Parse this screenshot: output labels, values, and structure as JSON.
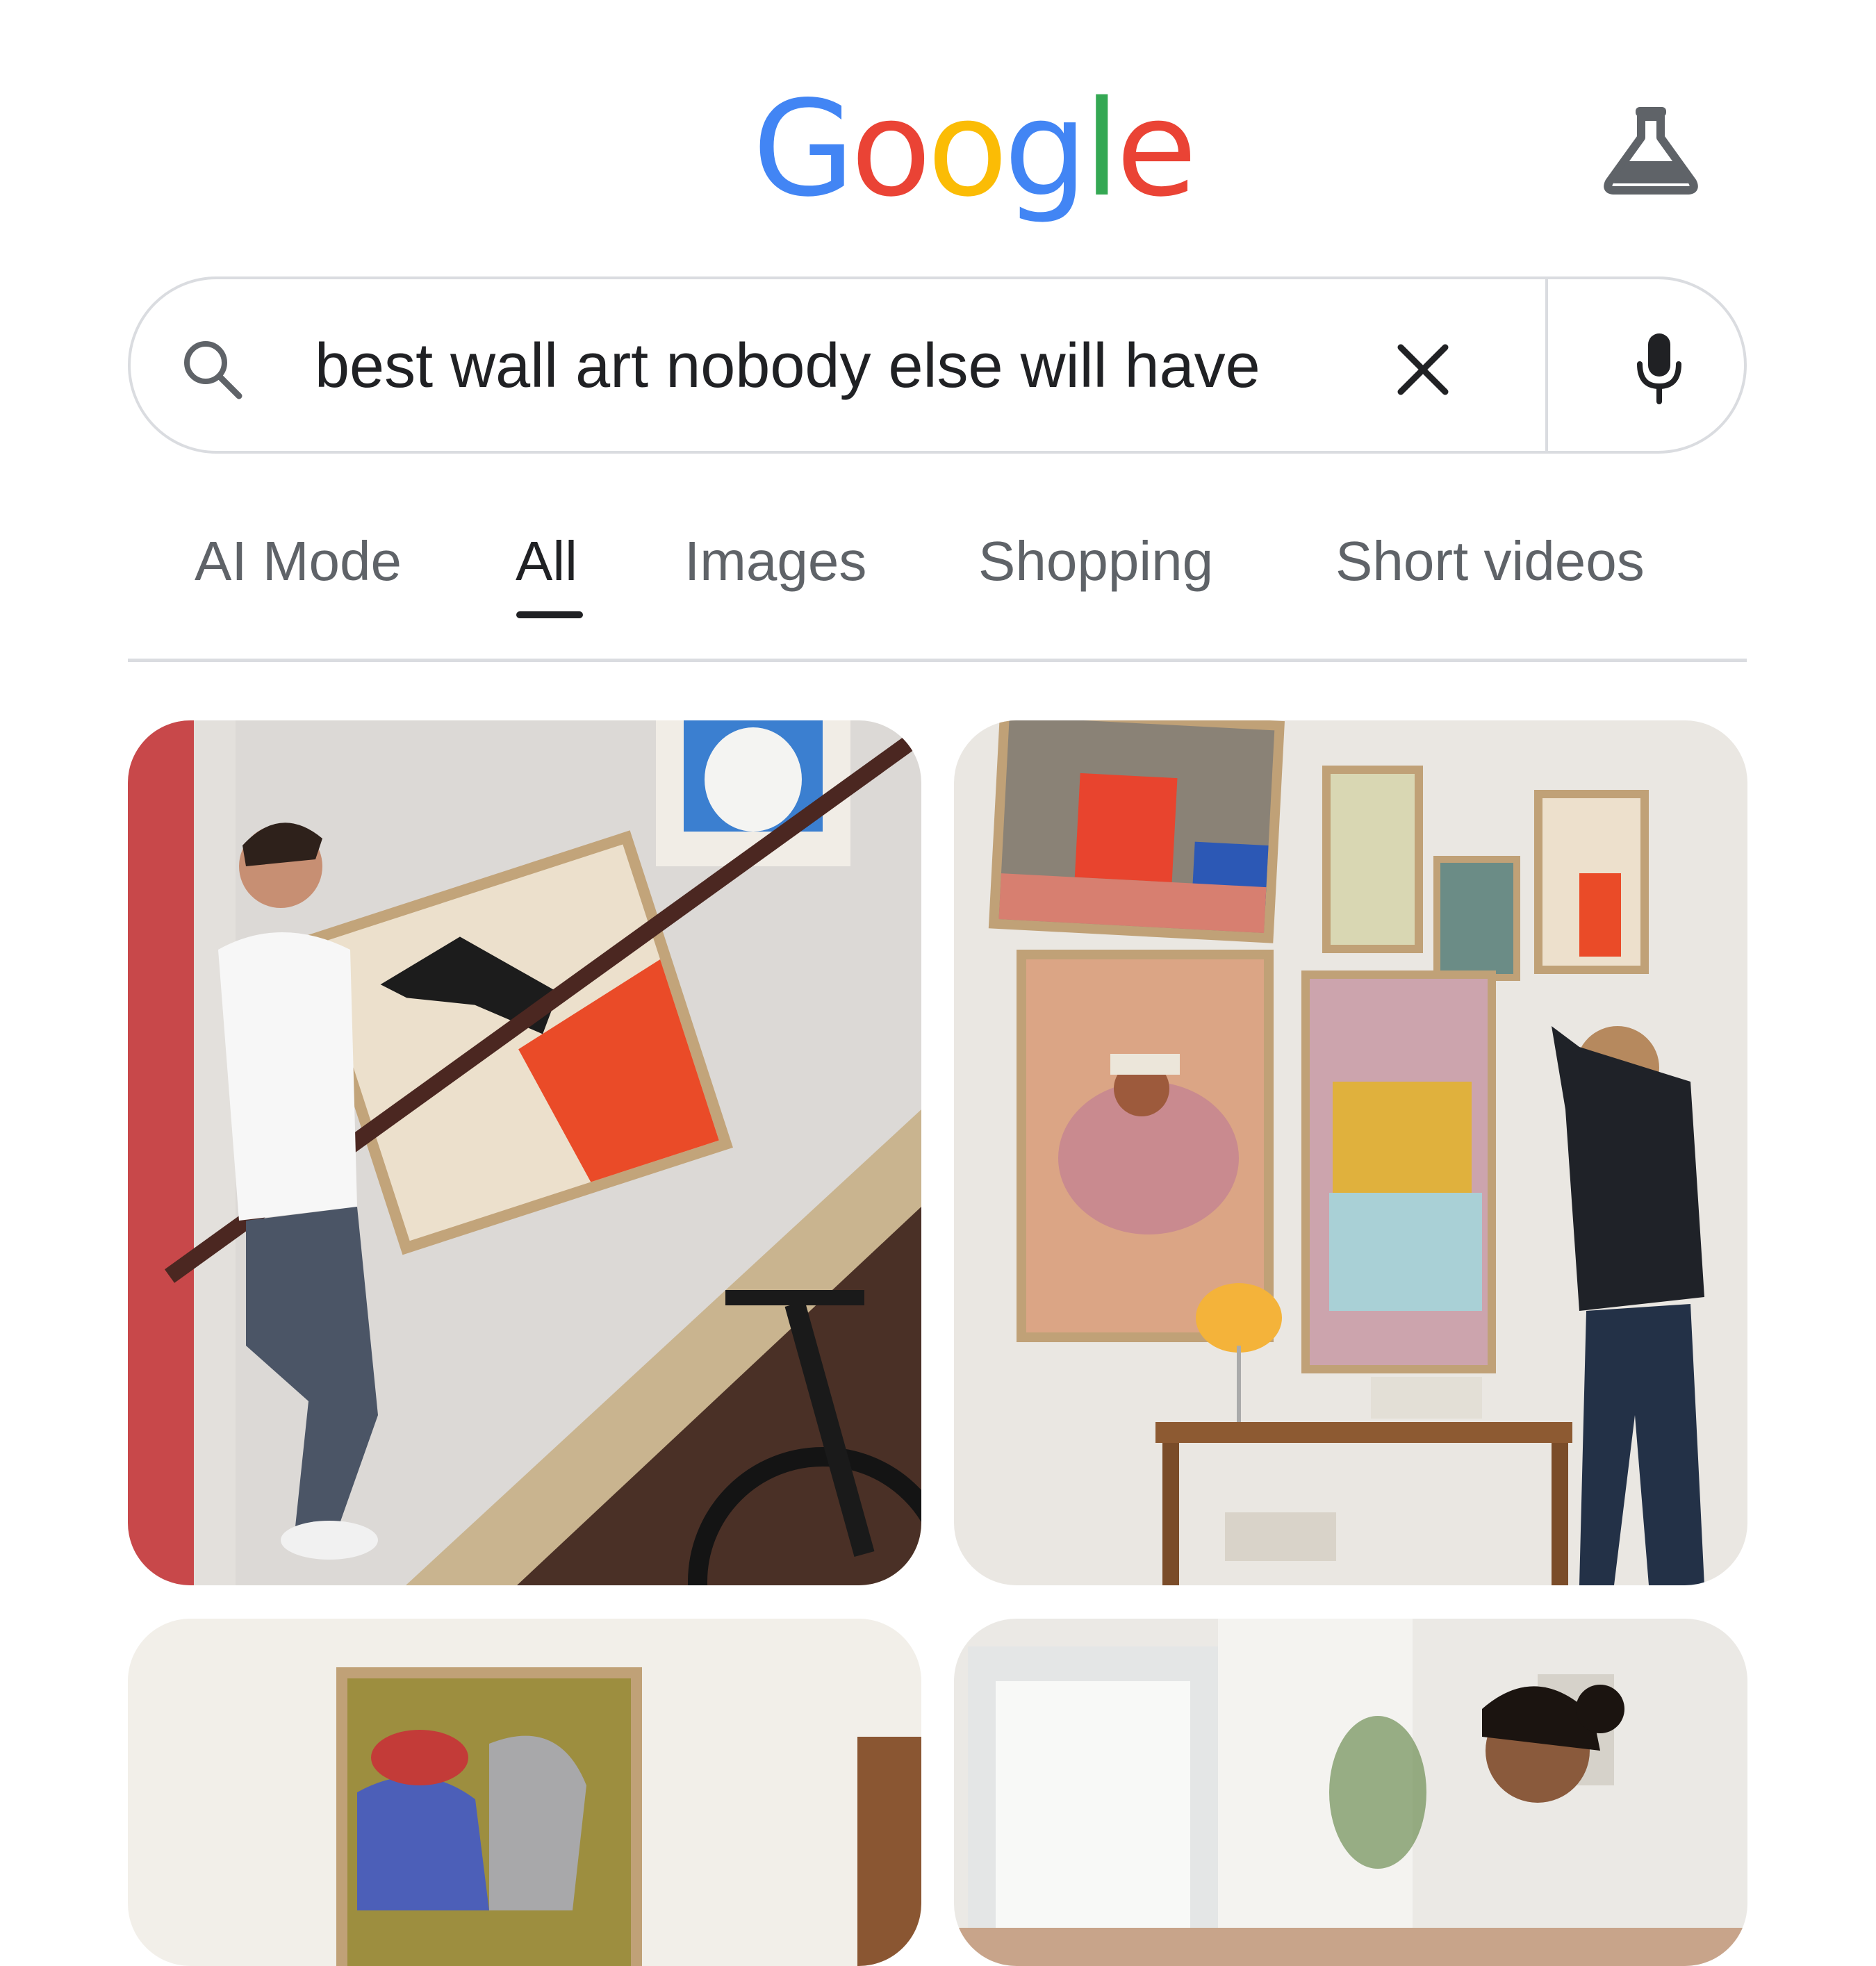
{
  "header": {
    "logo": {
      "letters": [
        "G",
        "o",
        "o",
        "g",
        "l",
        "e"
      ],
      "colors": [
        "#4285F4",
        "#EA4335",
        "#FBBC05",
        "#4285F4",
        "#34A853",
        "#EA4335"
      ]
    },
    "labs_icon": "flask-icon"
  },
  "search": {
    "query": "best wall art nobody else will have",
    "search_icon": "search-icon",
    "clear_icon": "close-icon",
    "voice_icon": "microphone-icon"
  },
  "tabs": [
    {
      "label": "AI Mode",
      "active": false
    },
    {
      "label": "All",
      "active": true
    },
    {
      "label": "Images",
      "active": false
    },
    {
      "label": "Shopping",
      "active": false
    },
    {
      "label": "Short videos",
      "active": false
    }
  ],
  "images": [
    {
      "id": "man-carrying-dog-painting-on-stairs"
    },
    {
      "id": "woman-hanging-gallery-wall"
    },
    {
      "id": "cowboy-horse-painting-room"
    },
    {
      "id": "woman-smiling-in-bright-room"
    }
  ]
}
